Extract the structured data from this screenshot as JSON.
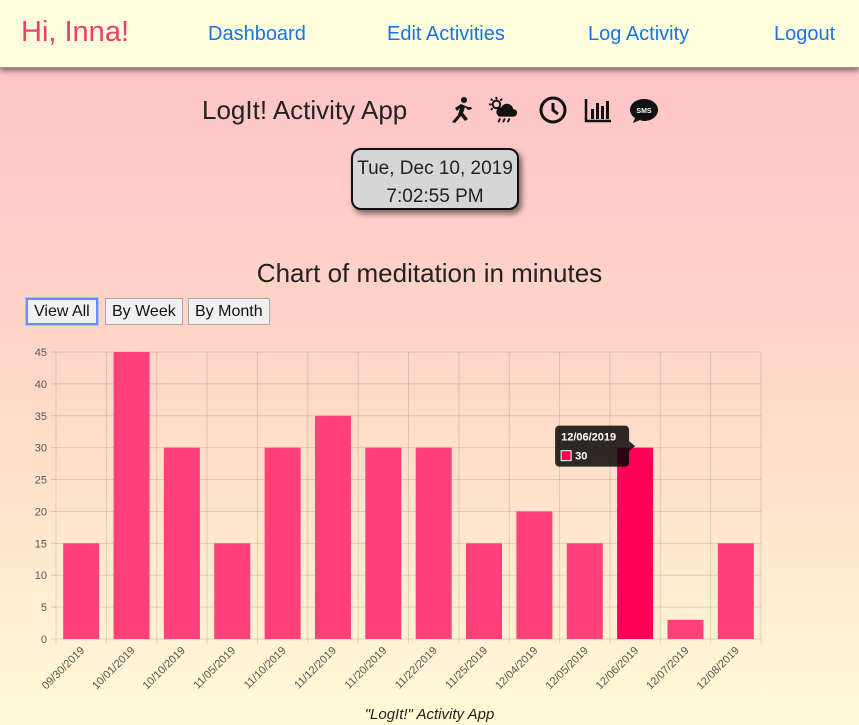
{
  "nav": {
    "greeting": "Hi, Inna!",
    "links": [
      "Dashboard",
      "Edit Activities",
      "Log Activity",
      "Logout"
    ]
  },
  "header": {
    "title": "LogIt! Activity App",
    "icons": [
      "running-icon",
      "weather-icon",
      "clock-icon",
      "chart-icon",
      "sms-icon"
    ]
  },
  "datetime": {
    "date": "Tue, Dec 10, 2019",
    "time": "7:02:55 PM"
  },
  "chart_section": {
    "title": "Chart of meditation in minutes",
    "buttons": [
      "View All",
      "By Week",
      "By Month"
    ],
    "active_button": "View All"
  },
  "chart_data": {
    "type": "bar",
    "categories": [
      "09/30/2019",
      "10/01/2019",
      "10/10/2019",
      "11/05/2019",
      "11/10/2019",
      "11/12/2019",
      "11/20/2019",
      "11/22/2019",
      "11/25/2019",
      "12/04/2019",
      "12/05/2019",
      "12/06/2019",
      "12/07/2019",
      "12/08/2019"
    ],
    "values": [
      15,
      45,
      30,
      15,
      30,
      35,
      30,
      30,
      15,
      20,
      15,
      30,
      3,
      15
    ],
    "ylim": [
      0,
      45
    ],
    "yticks": [
      0,
      5,
      10,
      15,
      20,
      25,
      30,
      35,
      40,
      45
    ],
    "grid": true,
    "colors": {
      "bar": "#ff4079",
      "bar_highlight": "#ff0056"
    },
    "tooltip": {
      "category": "12/06/2019",
      "value": "30"
    }
  },
  "footer": "\"LogIt!\" Activity App"
}
